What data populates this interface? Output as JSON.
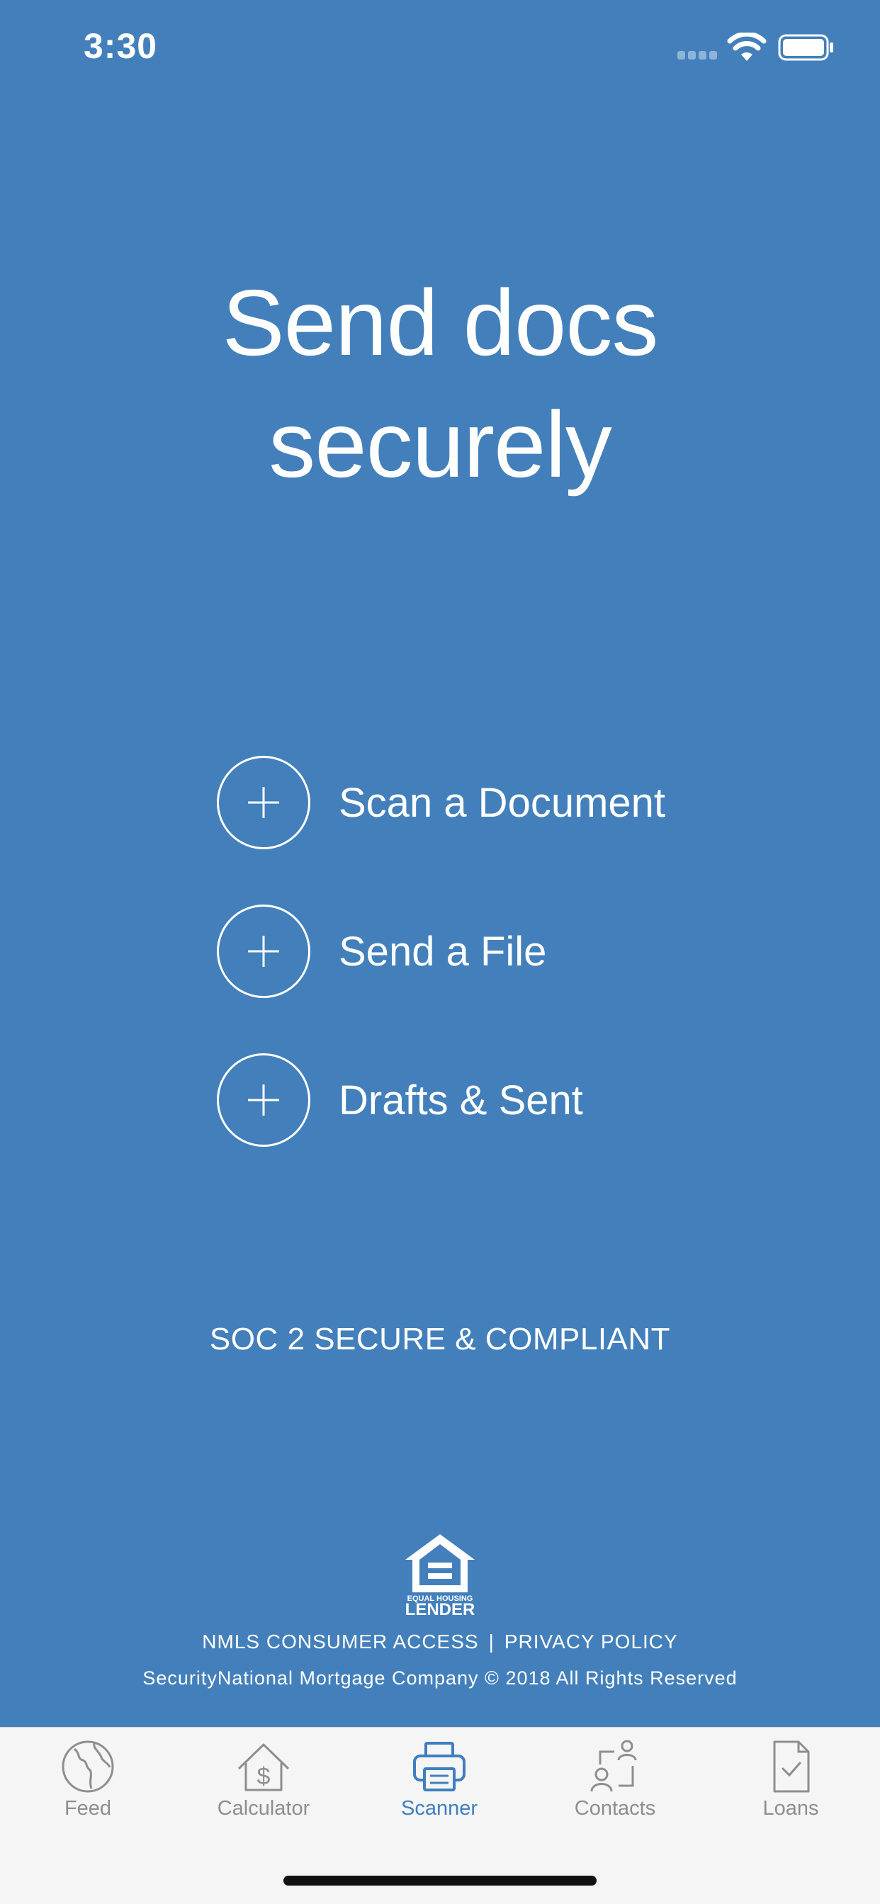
{
  "status_bar": {
    "time": "3:30"
  },
  "headline": {
    "line1": "Send docs",
    "line2": "securely"
  },
  "actions": [
    {
      "label": "Scan a Document",
      "icon": "plus-icon"
    },
    {
      "label": "Send a File",
      "icon": "plus-icon"
    },
    {
      "label": "Drafts & Sent",
      "icon": "plus-icon"
    }
  ],
  "compliance": "SOC 2 SECURE & COMPLIANT",
  "footer": {
    "logo_text_top": "EQUAL HOUSING",
    "logo_text_bottom": "LENDER",
    "link_nmls": "NMLS CONSUMER ACCESS",
    "separator": "|",
    "link_privacy": "PRIVACY POLICY",
    "copyright": "SecurityNational Mortgage Company © 2018 All Rights Reserved"
  },
  "tabs": [
    {
      "label": "Feed",
      "icon": "globe-icon",
      "active": false
    },
    {
      "label": "Calculator",
      "icon": "house-dollar-icon",
      "active": false
    },
    {
      "label": "Scanner",
      "icon": "printer-icon",
      "active": true
    },
    {
      "label": "Contacts",
      "icon": "contacts-icon",
      "active": false
    },
    {
      "label": "Loans",
      "icon": "document-check-icon",
      "active": false
    }
  ],
  "colors": {
    "background": "#4380bb",
    "tab_bar": "#f5f5f5",
    "tab_active": "#3f7fbf",
    "tab_inactive": "#8e8e8e"
  }
}
